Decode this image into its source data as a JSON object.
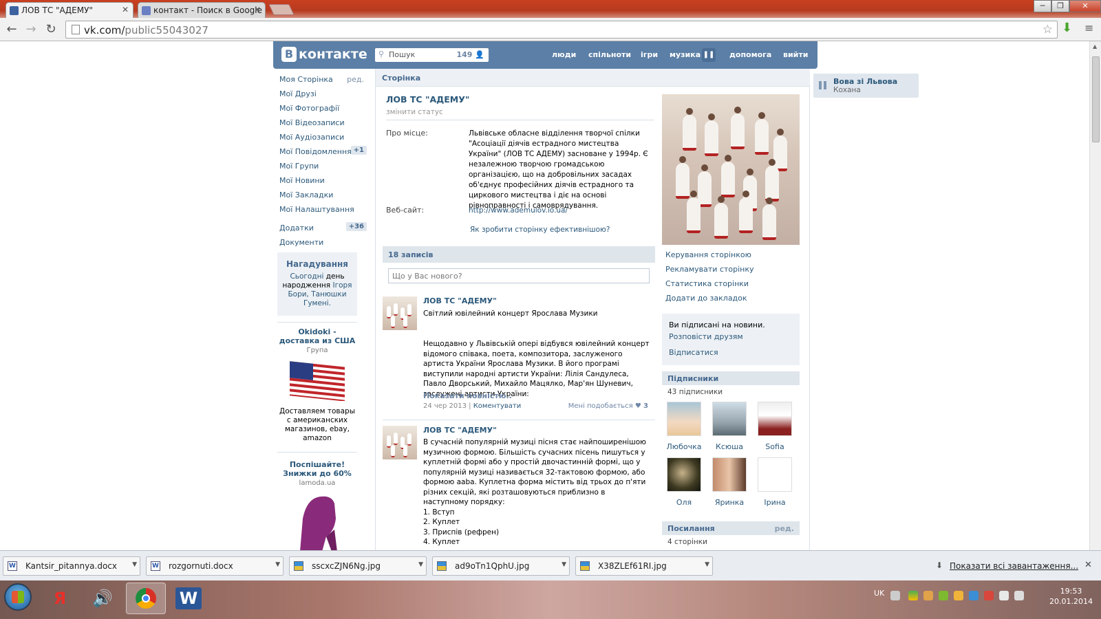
{
  "browser": {
    "tabs": [
      {
        "title": "ЛОВ ТС \"АДЕМУ\"",
        "active": true
      },
      {
        "title": "контакт - Поиск в Google",
        "active": false
      }
    ],
    "url_host": "vk.com/",
    "url_path": "public55043027"
  },
  "vk": {
    "logo": "контакте",
    "logo_letter": "В",
    "search_placeholder": "Пошук",
    "online_count": "149",
    "nav": [
      "люди",
      "спільноти",
      "ігри",
      "музика",
      "допомога",
      "вийти"
    ]
  },
  "left_menu": [
    {
      "label": "Моя Сторінка",
      "extra": "ред."
    },
    {
      "label": "Мої Друзі"
    },
    {
      "label": "Мої Фотографії"
    },
    {
      "label": "Мої Відеозаписи"
    },
    {
      "label": "Мої Аудіозаписи"
    },
    {
      "label": "Мої Повідомлення",
      "badge": "+1"
    },
    {
      "label": "Мої Групи"
    },
    {
      "label": "Мої Новини"
    },
    {
      "label": "Мої Закладки"
    },
    {
      "label": "Мої Налаштування"
    },
    {
      "label": "Додатки",
      "badge": "+36"
    },
    {
      "label": "Документи"
    }
  ],
  "reminder": {
    "title": "Нагадування",
    "pre": "Сьогодні",
    "mid": "день народження",
    "names": "Ігоря Бори, Танюшки Гумені."
  },
  "ads": [
    {
      "title": "Okidoki - доставка из США",
      "sub": "Група",
      "desc": "Доставляем товары с американских магазинов, ebay, amazon"
    },
    {
      "title": "Поспішайте! Знижки до 60%",
      "sub": "lamoda.ua"
    }
  ],
  "page": {
    "crumb": "Сторінка",
    "title": "ЛОВ ТС \"АДЕМУ\"",
    "status": "змінити статус",
    "about_label": "Про місце:",
    "about_text": "Львівське обласне відділення творчої спілки \"Асоціації діячів естрадного мистецтва України\" (ЛОВ ТС АДЕМУ) засноване у 1994р. Є незалежною творчою громадською організацією, що на добровільних засадах об'єднує професійних діячів естрадного та циркового мистецтва і діє на основі рівноправності і самоврядування.",
    "site_label": "Веб-сайт:",
    "site_url": "http://www.ademulov.io.ua/",
    "improve": "Як зробити сторінку ефективнішою?"
  },
  "actions": [
    "Керування сторінкою",
    "Рекламувати сторінку",
    "Статистика сторінки",
    "Додати до закладок"
  ],
  "subscription": {
    "subscribed": "Ви підписані на новини.",
    "tell": "Розповісти друзям",
    "unsub": "Відписатися"
  },
  "followers": {
    "header": "Підписники",
    "count": "43 підписники",
    "people": [
      "Любочка",
      "Ксюша",
      "Sofia",
      "Оля",
      "Яринка",
      "Ірина"
    ]
  },
  "links": {
    "header": "Посилання",
    "edit": "ред.",
    "count": "4 сторінки"
  },
  "wall": {
    "header": "18 записів",
    "input_placeholder": "Що у Вас нового?",
    "posts": [
      {
        "author": "ЛОВ ТС \"АДЕМУ\"",
        "headline": "Світлий ювілейний концерт Ярослава Музики",
        "text": "Нещодавно у Львівській опері відбувся ювілейний концерт відомого співака, поета, композитора, заслуженого артиста України Ярослава Музики. В його програмі виступили народні артисти України: Лілія Сандулеса, Павло Дворський, Михайло Мацялко, Мар'ян Шуневич, заслужені артисти України:",
        "more": "Показати повністю..",
        "date": "24 чер 2013",
        "comment": "Коментувати",
        "like": "Мені подобається",
        "likes": "3"
      },
      {
        "author": "ЛОВ ТС \"АДЕМУ\"",
        "text": "В сучасній популярній музиці пісня стає найпоширенішою музичною формою. Більшість сучасних пісень пишуться у куплетній формі або у простій двочастинній формі, що у популярній музиці називається 32-тактовою формою, або формою aaba. Куплетна форма містить від трьох до п'яти різних секцій, які розташовуються приблизно в наступному порядку:\n1. Вступ\n2. Куплет\n3. Приспів (рефрен)\n4. Куплет"
      }
    ]
  },
  "player": {
    "artist": "Вова зі Львова",
    "track": "Кохана"
  },
  "downloads": {
    "items": [
      {
        "name": "Kantsir_pitannya.docx",
        "type": "W"
      },
      {
        "name": "rozgornuti.docx",
        "type": "W"
      },
      {
        "name": "sscxcZJN6Ng.jpg",
        "type": "img"
      },
      {
        "name": "ad9oTn1QphU.jpg",
        "type": "img"
      },
      {
        "name": "X38ZLEf61RI.jpg",
        "type": "img"
      }
    ],
    "show_all": "Показати всі завантаження..."
  },
  "taskbar": {
    "lang": "UK",
    "time": "19:53",
    "date": "20.01.2014"
  },
  "colors": {
    "vk_blue": "#5b7fa6",
    "link": "#2b587a",
    "chrome_frame": "#b73a1f"
  }
}
